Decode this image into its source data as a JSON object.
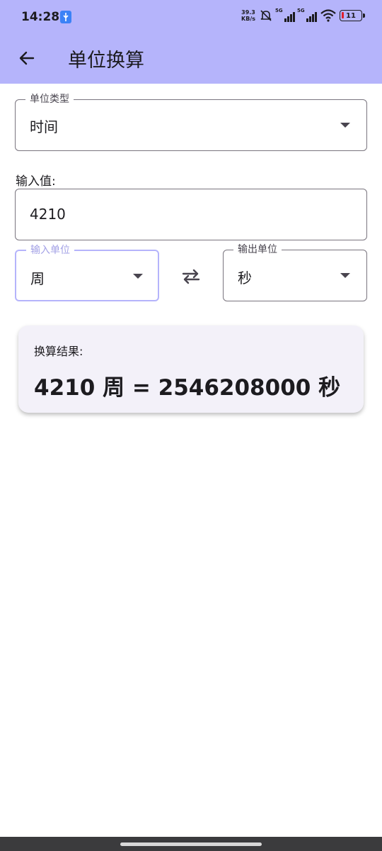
{
  "status_bar": {
    "time": "14:28",
    "net_speed_value": "39.3",
    "net_speed_unit": "KB/s",
    "signal1_label": "5G",
    "signal2_label": "5G",
    "battery_level": "11"
  },
  "app_bar": {
    "title": "单位换算",
    "back_icon": "arrow-back-icon"
  },
  "unit_type": {
    "label": "单位类型",
    "value": "时间"
  },
  "input": {
    "label": "输入值:",
    "value": "4210"
  },
  "input_unit": {
    "label": "输入单位",
    "value": "周"
  },
  "output_unit": {
    "label": "输出单位",
    "value": "秒"
  },
  "result": {
    "label": "换算结果:",
    "text": "4210 周 = 2546208000 秒"
  },
  "colors": {
    "accent": "#b5b4fb",
    "card_bg": "#f3f1f9",
    "battery_low": "#e0202c"
  }
}
